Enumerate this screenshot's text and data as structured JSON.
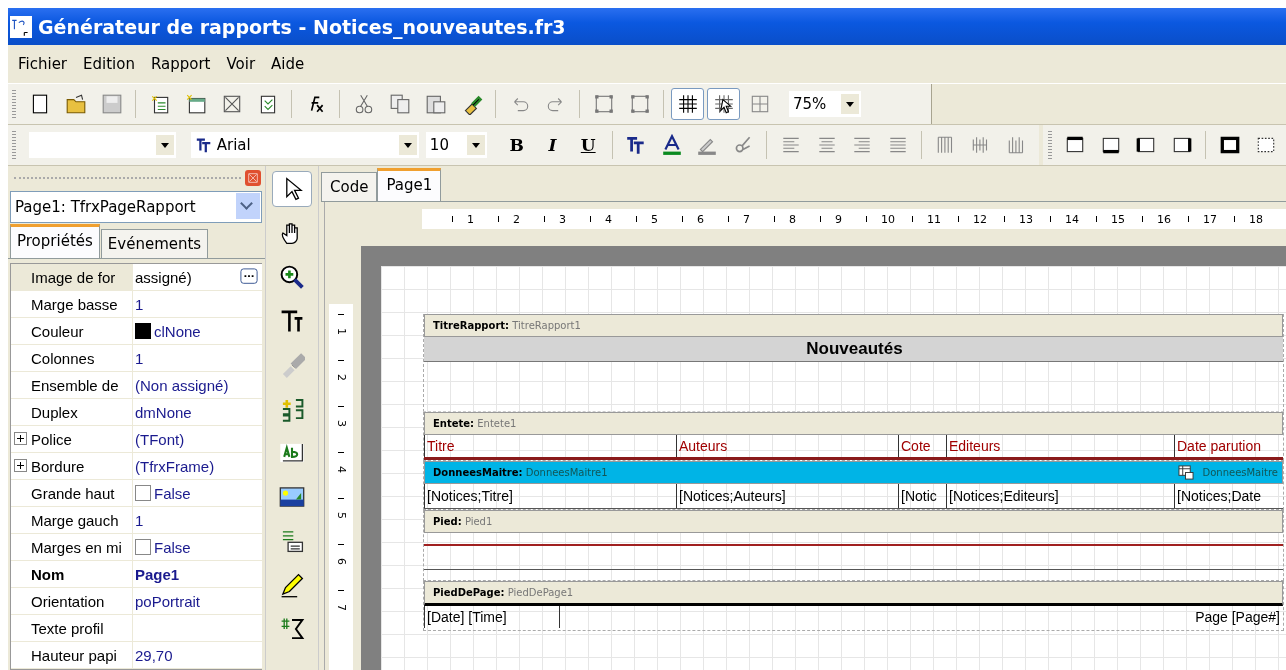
{
  "window": {
    "title": "Générateur de rapports - Notices_nouveautes.fr3"
  },
  "menu": [
    "Fichier",
    "Edition",
    "Rapport",
    "Voir",
    "Aide"
  ],
  "toolbar": {
    "zoom": "75%",
    "grid_shown": true,
    "snap_to_grid": true
  },
  "format_bar": {
    "font": "Arial",
    "size": "10",
    "buttons": [
      {
        "label": "B",
        "kind": "bold"
      },
      {
        "label": "I",
        "kind": "italic"
      },
      {
        "label": "U",
        "kind": "underline"
      }
    ]
  },
  "inspector": {
    "object": "Page1: TfrxPageRapport",
    "tabs": [
      {
        "label": "Propriétés",
        "selected": true
      },
      {
        "label": "Evénements",
        "selected": false
      }
    ],
    "properties": [
      {
        "name": "Image de for",
        "value": "assigné)",
        "kind": "ellipsis",
        "selected": true
      },
      {
        "name": "Marge basse",
        "value": "1",
        "kind": "text",
        "selected": false
      },
      {
        "name": "Couleur",
        "value": "clNone",
        "kind": "color",
        "selected": false
      },
      {
        "name": "Colonnes",
        "value": "1",
        "kind": "text",
        "selected": false
      },
      {
        "name": "Ensemble de",
        "value": "(Non assigné)",
        "kind": "text",
        "selected": false
      },
      {
        "name": "Duplex",
        "value": "dmNone",
        "kind": "text",
        "selected": false
      },
      {
        "name": "Police",
        "value": "(TFont)",
        "kind": "expandable",
        "expanded": false,
        "selected": false
      },
      {
        "name": "Bordure",
        "value": "(TfrxFrame)",
        "kind": "expandable",
        "expanded": false,
        "selected": false
      },
      {
        "name": "Grande haut",
        "value": "False",
        "kind": "checkbox",
        "checked": false,
        "selected": false
      },
      {
        "name": "Marge gauch",
        "value": "1",
        "kind": "text",
        "selected": false
      },
      {
        "name": "Marges en mi",
        "value": "False",
        "kind": "checkbox",
        "checked": false,
        "selected": false
      },
      {
        "name": "Nom",
        "value": "Page1",
        "kind": "text",
        "bold": true,
        "selected": false
      },
      {
        "name": "Orientation",
        "value": "poPortrait",
        "kind": "text",
        "selected": false
      },
      {
        "name": "Texte profil",
        "kind": "text",
        "selected": false
      },
      {
        "name": "Hauteur papi",
        "value": "29,70",
        "kind": "text",
        "selected": false
      }
    ]
  },
  "designer": {
    "tabs": [
      {
        "label": "Code",
        "selected": false
      },
      {
        "label": "Page1",
        "selected": true
      }
    ],
    "ruler": [
      "1",
      "2",
      "3",
      "4",
      "5",
      "6",
      "7",
      "8",
      "9",
      "10",
      "11",
      "12",
      "13",
      "14",
      "15",
      "16",
      "17",
      "18"
    ],
    "side_ruler": [
      "1",
      "2",
      "3",
      "4",
      "5",
      "6",
      "7"
    ],
    "bands": [
      {
        "type": "TitreRapport:",
        "name": "TitreRapport1",
        "selected": false,
        "kind": "title",
        "cells": [
          "Nouveautés"
        ]
      },
      {
        "type": "Entete:",
        "name": "Entete1",
        "selected": false,
        "kind": "header",
        "cells": [
          "Titre",
          "Auteurs",
          "Cote",
          "Editeurs",
          "Date parution"
        ]
      },
      {
        "type": "DonneesMaitre:",
        "name": "DonneesMaitre1",
        "selected": true,
        "source": "DonneesMaitre",
        "kind": "data",
        "cells": [
          "[Notices;Titre]",
          "[Notices;Auteurs]",
          "[Notic",
          "[Notices;Editeurs]",
          "[Notices;Date"
        ]
      },
      {
        "type": "Pied:",
        "name": "Pied1",
        "selected": false,
        "kind": "footer"
      },
      {
        "type": "PiedDePage:",
        "name": "PiedDePage1",
        "selected": false,
        "kind": "pagefooter",
        "cells": [
          "[Date] [Time]",
          "Page [Page#]"
        ]
      }
    ]
  }
}
